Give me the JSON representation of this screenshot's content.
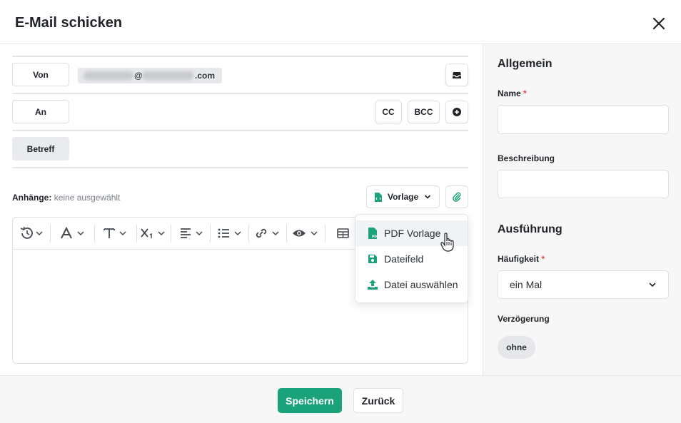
{
  "dialog": {
    "title": "E-Mail schicken"
  },
  "compose": {
    "from_label": "Von",
    "from_value_suffix": ".com",
    "from_value_at": "@",
    "to_label": "An",
    "cc_label": "CC",
    "bcc_label": "BCC",
    "subject_label": "Betreff",
    "attachments_label": "Anhänge:",
    "attachments_value": "keine ausgewählt",
    "template_button": "Vorlage"
  },
  "template_menu": {
    "items": [
      {
        "label": "PDF Vorlage",
        "icon": "pdf-file-icon"
      },
      {
        "label": "Dateifeld",
        "icon": "save-icon"
      },
      {
        "label": "Datei auswählen",
        "icon": "upload-icon"
      }
    ]
  },
  "editor_toolbar": {
    "icons": [
      "history-icon",
      "font-color-icon",
      "text-type-icon",
      "subscript-icon",
      "align-left-icon",
      "list-icon",
      "link-icon",
      "preview-eye-icon",
      "table-icon"
    ]
  },
  "sidebar": {
    "general_title": "Allgemein",
    "name_label": "Name",
    "required_mark": "*",
    "description_label": "Beschreibung",
    "execution_title": "Ausführung",
    "frequency_label": "Häufigkeit",
    "frequency_value": "ein Mal",
    "delay_label": "Verzögerung",
    "delay_value": "ohne"
  },
  "footer": {
    "save_label": "Speichern",
    "back_label": "Zurück"
  },
  "colors": {
    "accent": "#1aa37a",
    "required": "#e5484d"
  }
}
